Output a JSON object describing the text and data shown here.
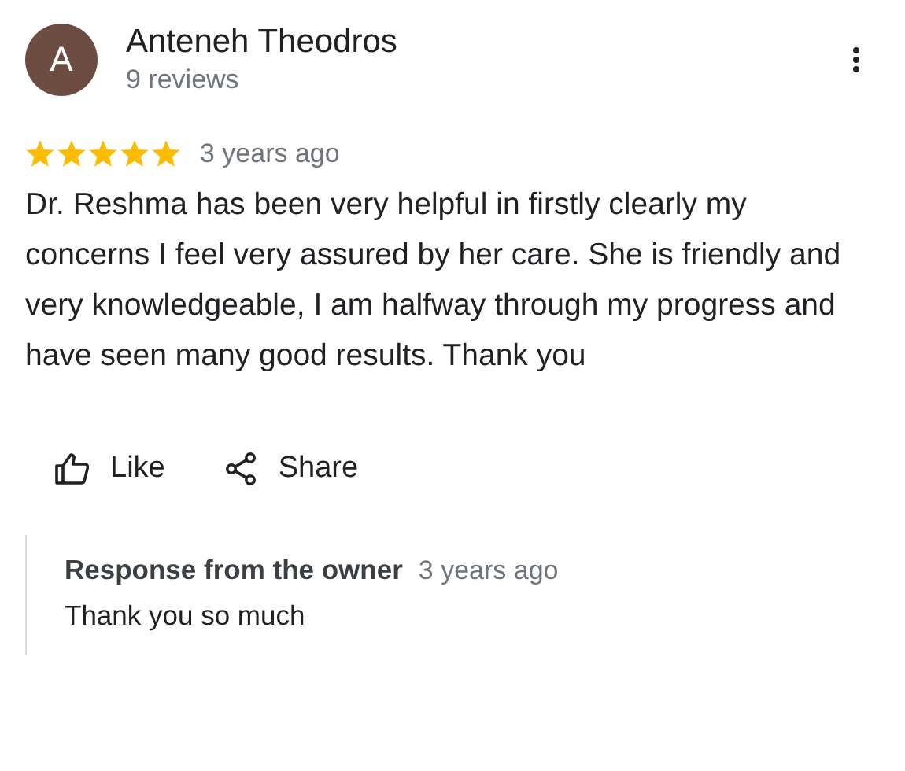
{
  "reviewer": {
    "initial": "A",
    "name": "Anteneh Theodros",
    "reviews": "9 reviews"
  },
  "review": {
    "stars": 5,
    "time": "3 years ago",
    "text": "Dr. Reshma has been very helpful in firstly clearly my concerns I feel very assured by her care. She is friendly and very knowledgeable, I am halfway through my progress and have seen many good results. Thank you"
  },
  "actions": [
    {
      "kind": "like",
      "label": "Like"
    },
    {
      "kind": "share",
      "label": "Share"
    }
  ],
  "owner_response": {
    "title": "Response from the owner",
    "time": "3 years ago",
    "text": "Thank you so much"
  }
}
